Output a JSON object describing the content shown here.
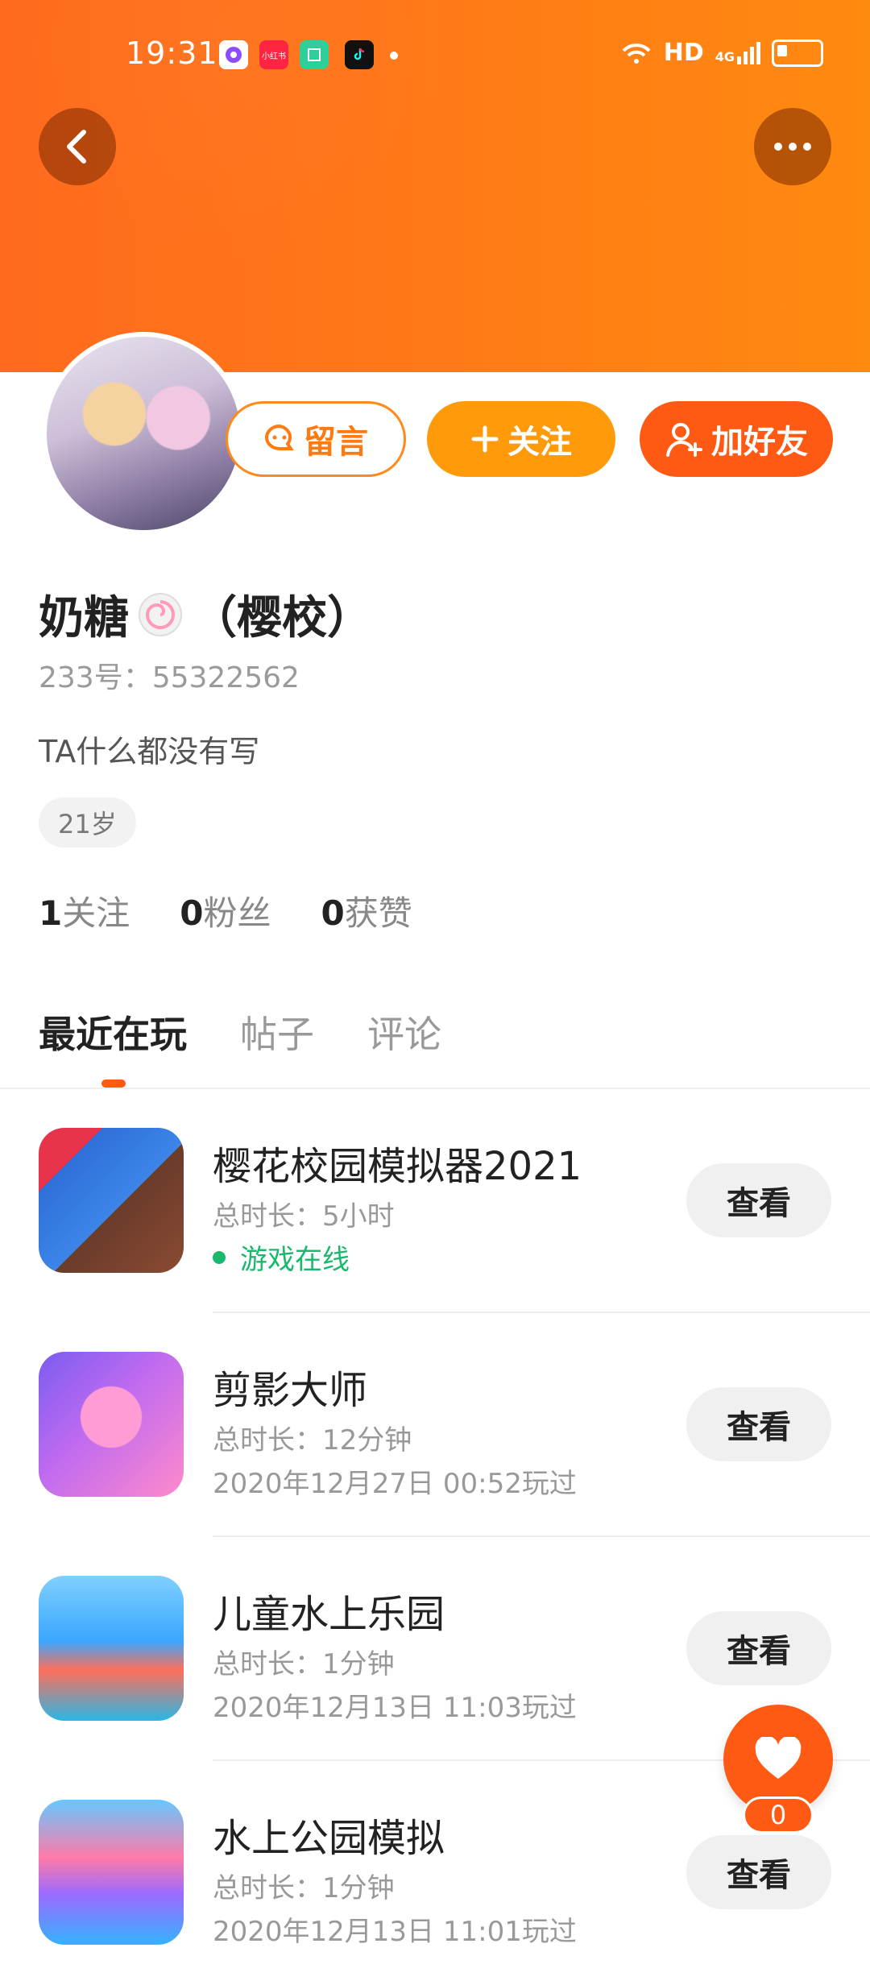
{
  "status_bar": {
    "time": "19:31",
    "apps": [
      "podcast-app-icon",
      "xiaohongshu-app-icon",
      "scanner-app-icon",
      "tiktok-app-icon"
    ],
    "xiaohongshu_label": "小红书",
    "hd": "HD",
    "network": "4G"
  },
  "profile": {
    "nickname": "奶糖",
    "nickname_suffix": "（樱校）",
    "uid": "233号：55322562",
    "bio": "TA什么都没有写",
    "age": "21岁"
  },
  "actions": {
    "message_label": "留言",
    "follow_label": "关注",
    "add_friend_label": "加好友"
  },
  "stats": [
    {
      "value": "1",
      "label": "关注"
    },
    {
      "value": "0",
      "label": "粉丝"
    },
    {
      "value": "0",
      "label": "获赞"
    }
  ],
  "tabs": [
    {
      "label": "最近在玩",
      "active": true
    },
    {
      "label": "帖子",
      "active": false
    },
    {
      "label": "评论",
      "active": false
    }
  ],
  "games": [
    {
      "title": "樱花校园模拟器2021",
      "duration": "总时长：5小时",
      "status": "游戏在线",
      "online": true,
      "view_label": "查看"
    },
    {
      "title": "剪影大师",
      "duration": "总时长：12分钟",
      "status": "2020年12月27日 00:52玩过",
      "online": false,
      "view_label": "查看"
    },
    {
      "title": "儿童水上乐园",
      "duration": "总时长：1分钟",
      "status": "2020年12月13日 11:03玩过",
      "online": false,
      "view_label": "查看"
    },
    {
      "title": "水上公园模拟",
      "duration": "总时长：1分钟",
      "status": "2020年12月13日 11:01玩过",
      "online": false,
      "view_label": "查看"
    }
  ],
  "like": {
    "count": "0"
  },
  "colors": {
    "accent": "#ff5a14",
    "follow": "#ff9a0a",
    "online": "#1ab86c"
  }
}
